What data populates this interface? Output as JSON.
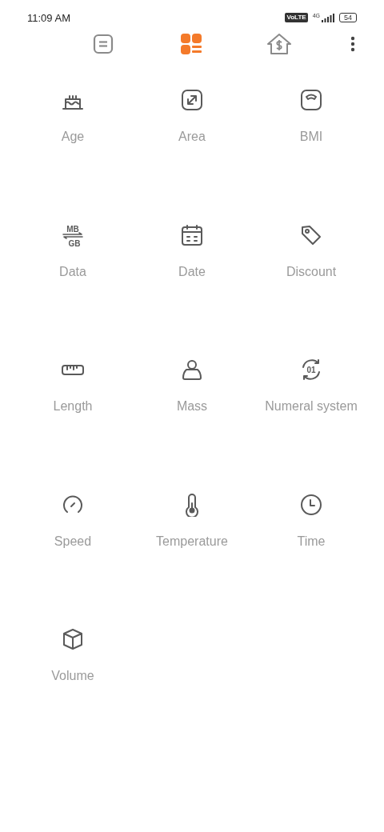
{
  "status_bar": {
    "time": "11:09 AM",
    "volte": "VoLTE",
    "network": "4G",
    "battery": "54"
  },
  "tabs": [
    {
      "selected": false
    },
    {
      "selected": true
    },
    {
      "selected": false
    }
  ],
  "converters": [
    {
      "label": "Age"
    },
    {
      "label": "Area"
    },
    {
      "label": "BMI"
    },
    {
      "label": "Data",
      "icon_text": [
        "MB",
        "GB"
      ]
    },
    {
      "label": "Date"
    },
    {
      "label": "Discount"
    },
    {
      "label": "Length"
    },
    {
      "label": "Mass"
    },
    {
      "label": "Numeral system",
      "icon_text": [
        "01"
      ]
    },
    {
      "label": "Speed"
    },
    {
      "label": "Temperature"
    },
    {
      "label": "Time"
    },
    {
      "label": "Volume"
    }
  ]
}
